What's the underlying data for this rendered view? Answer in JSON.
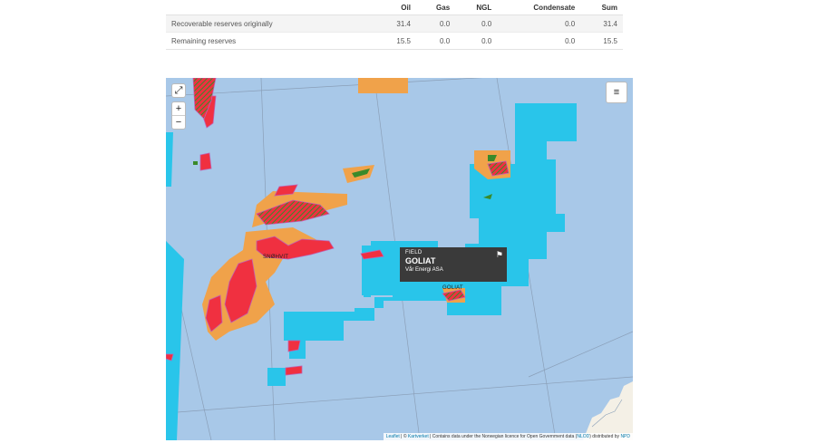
{
  "table": {
    "columns": [
      "",
      "Oil",
      "Gas",
      "NGL",
      "Condensate",
      "Sum"
    ],
    "rows": [
      {
        "label": "Recoverable reserves originally",
        "values": [
          "31.4",
          "0.0",
          "0.0",
          "0.0",
          "31.4"
        ]
      },
      {
        "label": "Remaining reserves",
        "values": [
          "15.5",
          "0.0",
          "0.0",
          "0.0",
          "15.5"
        ]
      }
    ]
  },
  "map": {
    "controls": {
      "fullscreen": "⤢",
      "zoom_in": "+",
      "zoom_out": "−",
      "layers": "≡"
    },
    "popup": {
      "type": "FIELD",
      "name": "GOLIAT",
      "operator": "Vår Energi ASA",
      "icon": "map-icon"
    },
    "labels": {
      "snohvit": "SNØHVIT",
      "goliat": "GOLIAT"
    },
    "attribution": {
      "leaflet": "Leaflet",
      "sep1": " | © ",
      "kartverket": "Kartverket",
      "text": " | Contains data under the Norwegian licence for Open Government data (",
      "nlod": "NLOD",
      "text2": ") distributed by ",
      "npd": "NPD"
    },
    "colors": {
      "sea": "#a8c8e8",
      "cyan": "#29c5ea",
      "orange": "#f0a24a",
      "red": "#f03040",
      "green": "#3a8a2a",
      "magenta": "#b080c8"
    }
  }
}
